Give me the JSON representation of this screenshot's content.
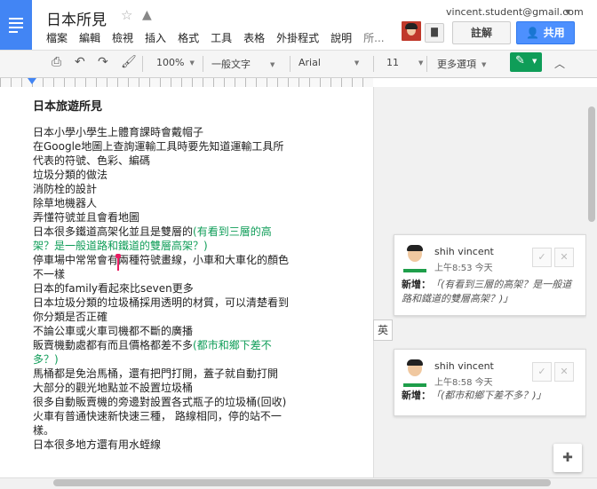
{
  "header": {
    "doc_title": "日本所見",
    "account_email": "vincent.student@gmail.com",
    "menus": [
      "檔案",
      "編輯",
      "檢視",
      "插入",
      "格式",
      "工具",
      "表格",
      "外掛程式",
      "說明",
      "所..."
    ],
    "comments_label": "註解",
    "share_label": "共用"
  },
  "toolbar": {
    "zoom": "100%",
    "style": "一般文字",
    "font": "Arial",
    "size": "11",
    "more": "更多選項"
  },
  "document": {
    "heading": "日本旅遊所見",
    "lines": [
      {
        "text": "日本小學小學生上體育課時會戴帽子"
      },
      {
        "text": "在Google地圖上查詢運輸工具時要先知道運輸工具所代表的符號、色彩、編碼"
      },
      {
        "text": "垃圾分類的做法"
      },
      {
        "text": "消防栓的設計"
      },
      {
        "text": "除草地機器人"
      },
      {
        "text": "弄懂符號並且會看地圖"
      },
      {
        "text": "日本很多鐵道高架化並且是雙層的",
        "highlight": "(有看到三層的高架？是一般道路和鐵道的雙層高架？)"
      },
      {
        "text": "停車場中常常會有兩種符號畫線，小車和大車化的顏色不一樣"
      },
      {
        "text": "日本的family看起來比seven更多"
      },
      {
        "text": "日本垃圾分類的垃圾桶採用透明的材質，可以清楚看到你分類是否正確"
      },
      {
        "text": "不論公車或火車司機都不斷的廣播"
      },
      {
        "text": "販賣機動處都有而且價格都差不多",
        "highlight": "(都市和鄉下差不多？)"
      },
      {
        "text": "馬桶都是免治馬桶，還有把門打開，蓋子就自動打開"
      },
      {
        "text": "大部分的觀光地點並不設置垃圾桶"
      },
      {
        "text": "很多自動販賣機的旁邊對設置各式瓶子的垃圾桶(回收)"
      },
      {
        "text": "火車有普通快速新快速三種， 路線相同，停的站不一樣。"
      },
      {
        "text": "日本很多地方還有用水蛭線"
      }
    ]
  },
  "comments": [
    {
      "author": "shih vincent",
      "time": "上午8:53 今天",
      "label": "新增：",
      "quote": "「(有看到三層的高架？是一般道路和鐵道的雙層高架？)」"
    },
    {
      "author": "shih vincent",
      "time": "上午8:58 今天",
      "label": "新增：",
      "quote": "「(都市和鄉下差不多？)」"
    }
  ],
  "lang_indicator": "英",
  "colors": {
    "brand_blue": "#4285f4",
    "share_blue": "#4d90fe",
    "highlight_green": "#0f9d58",
    "cursor_pink": "#e91e63"
  }
}
